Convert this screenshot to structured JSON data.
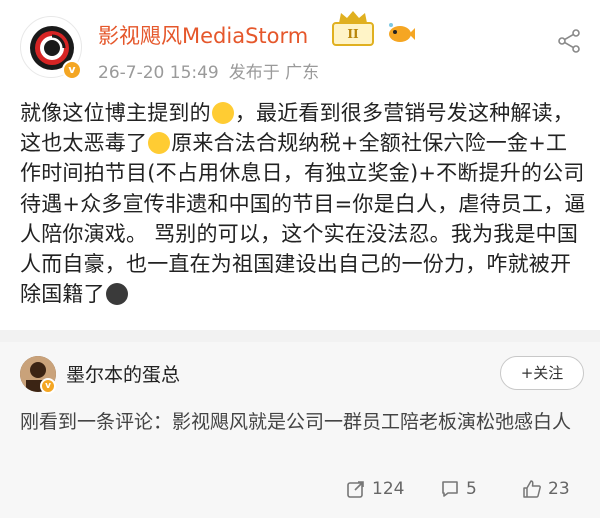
{
  "post": {
    "author_name": "影视飓风MediaStorm",
    "vip_level": "II",
    "timestamp": "26-7-20 15:49",
    "location": "发布于 广东",
    "verified_mark": "v",
    "body": {
      "seg1": "就像这位博主提到的",
      "seg2": "，最近看到很多营销号发这种解读，这也太恶毒了",
      "seg3": "原来合法合规纳税+全额社保六险一金+工作时间拍节目(不占用休息日，有独立奖金)+不断提升的公司待遇+众多宣传非遗和中国的节目=你是白人，虐待员工，逼人陪你演戏。 骂别的可以，这个实在没法忍。我为我是中国人而自豪，也一直在为祖国建设出自己的一份力，咋就被开除国籍了"
    },
    "emojis": [
      "crying-emoji",
      "lol-tears-emoji",
      "dark-face-emoji"
    ]
  },
  "comment": {
    "author_name": "墨尔本的蛋总",
    "verified_mark": "v",
    "follow_label": "+关注",
    "text": "刚看到一条评论：影视飓风就是公司一群员工陪老板演松弛感白人"
  },
  "actions": {
    "repost_count": "124",
    "comment_count": "5",
    "like_count": "23"
  },
  "colors": {
    "author_name": "#e5572b",
    "verify_badge": "#f4a623",
    "meta_text": "#9a9a9a",
    "background": "#f2f2f2"
  }
}
